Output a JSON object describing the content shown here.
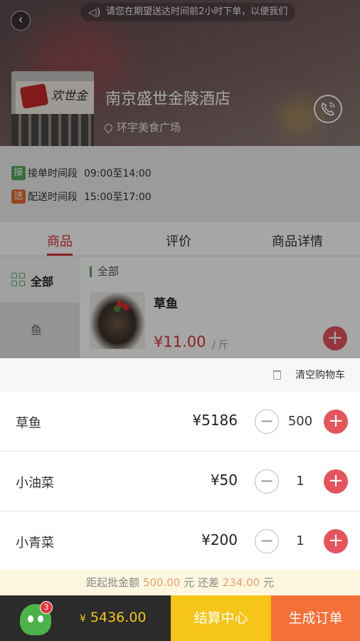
{
  "notice": {
    "text": "请您在期望送达时间前2小时下单，以便我们"
  },
  "store": {
    "name": "南京盛世金陵酒店",
    "location": "环宇美食广场",
    "sign_text": "欢世金"
  },
  "info": {
    "accept": {
      "tag": "接",
      "label": "接单时间段",
      "value": "09:00至14:00"
    },
    "delivery": {
      "tag": "送",
      "label": "配送时间段",
      "value": "15:00至17:00"
    }
  },
  "tabs": [
    {
      "label": "商品",
      "active": true
    },
    {
      "label": "评价",
      "active": false
    },
    {
      "label": "商品详情",
      "active": false
    }
  ],
  "categories": [
    {
      "label": "全部",
      "active": true
    },
    {
      "label": "鱼",
      "active": false
    }
  ],
  "section_title": "全部",
  "product": {
    "name": "草鱼",
    "price": "¥11.00",
    "unit": "/ 斤"
  },
  "cart": {
    "clear_label": "清空购物车",
    "items": [
      {
        "name": "草鱼",
        "price": "¥5186",
        "qty": "500"
      },
      {
        "name": "小油菜",
        "price": "¥50",
        "qty": "1"
      },
      {
        "name": "小青菜",
        "price": "¥200",
        "qty": "1"
      }
    ]
  },
  "min_order": {
    "prefix": "距起批金额",
    "amount": "500.00",
    "unit1": "元 还差",
    "diff": "234.00",
    "unit2": "元"
  },
  "bottom": {
    "badge": "3",
    "currency": "¥",
    "total": "5436.00",
    "checkout": "结算中心",
    "order": "生成订单"
  },
  "colors": {
    "accent": "#d9343e",
    "green": "#5aa85c",
    "checkout": "#f6c51a",
    "order": "#f56f38"
  }
}
